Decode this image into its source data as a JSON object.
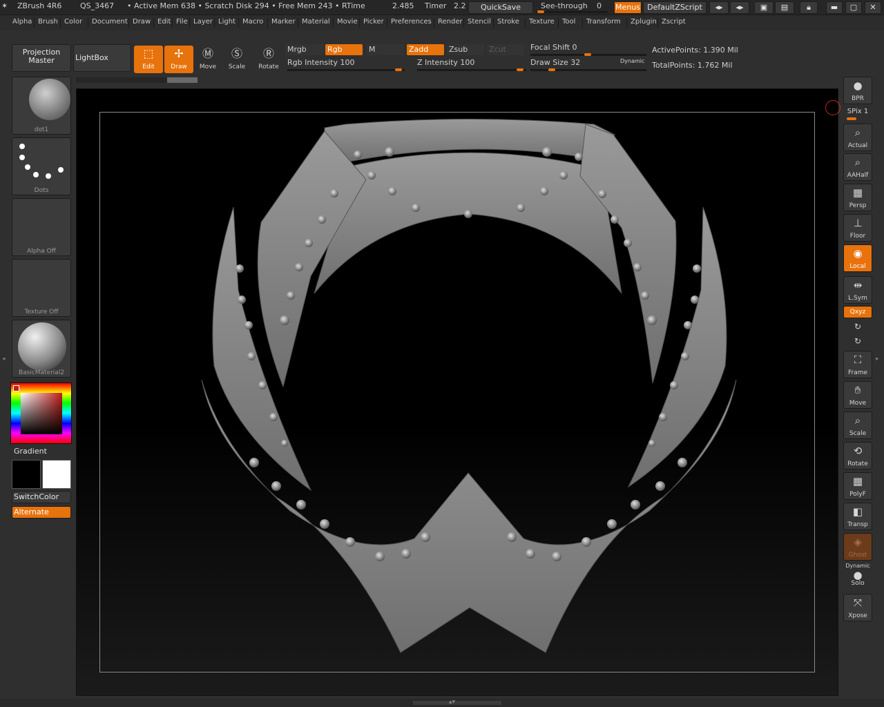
{
  "titlebar": {
    "app": "ZBrush 4R6",
    "session": "QS_3467",
    "stats": "• Active Mem 638 • Scratch Disk 294 • Free Mem 243 • RTime",
    "rtime": "2.485",
    "timer_label": "Timer",
    "timer": "2.2",
    "quicksave": "QuickSave",
    "seethrough": "See-through",
    "seethrough_value": "0",
    "menus": "Menus",
    "default_zscript": "DefaultZScript"
  },
  "menubar": {
    "items": [
      "Alpha",
      "Brush",
      "Color",
      "Document",
      "Draw",
      "Edit",
      "File",
      "Layer",
      "Light",
      "Macro",
      "Marker",
      "Material",
      "Movie",
      "Picker",
      "Preferences",
      "Render",
      "Stencil",
      "Stroke",
      "Texture",
      "Tool",
      "Transform",
      "Zplugin",
      "Zscript"
    ]
  },
  "toolbar": {
    "projection_master": [
      "Projection",
      "Master"
    ],
    "lightbox": "LightBox",
    "edit": "Edit",
    "draw": "Draw",
    "move": "Move",
    "scale": "Scale",
    "rotate": "Rotate",
    "mrgb": "Mrgb",
    "rgb": "Rgb",
    "m": "M",
    "zadd": "Zadd",
    "zsub": "Zsub",
    "zcut": "Zcut",
    "rgb_intensity": "Rgb Intensity 100",
    "z_intensity": "Z Intensity 100",
    "focal_shift": "Focal Shift 0",
    "draw_size": "Draw Size 32",
    "dynamic": "Dynamic",
    "active_points": "ActivePoints: 1.390 Mil",
    "total_points": "TotalPoints: 1.762 Mil"
  },
  "leftshelf": {
    "brush_thumb": "dot1",
    "stroke_thumb": "Dots",
    "alpha_thumb": "Alpha Off",
    "texture_thumb": "Texture Off",
    "material_thumb": "BasicMaterial2",
    "gradient": "Gradient",
    "switchcolor": "SwitchColor",
    "alternate": "Alternate"
  },
  "rightshelf": {
    "bpr": "BPR",
    "spix": "SPix 1",
    "actual": "Actual",
    "aahalf": "AAHalf",
    "persp": "Persp",
    "floor": "Floor",
    "local": "Local",
    "lsym": "L.Sym",
    "xyz": "Qxyz",
    "frame": "Frame",
    "move": "Move",
    "scale": "Scale",
    "rotate": "Rotate",
    "polyf": "PolyF",
    "transp": "Transp",
    "ghost": "Ghost",
    "dynamic": "Dynamic",
    "solo": "Solo",
    "xpose": "Xpose"
  },
  "colors": {
    "accent": "#e8720c",
    "panel": "#2f2f2f",
    "model": "#8a8a8a"
  }
}
